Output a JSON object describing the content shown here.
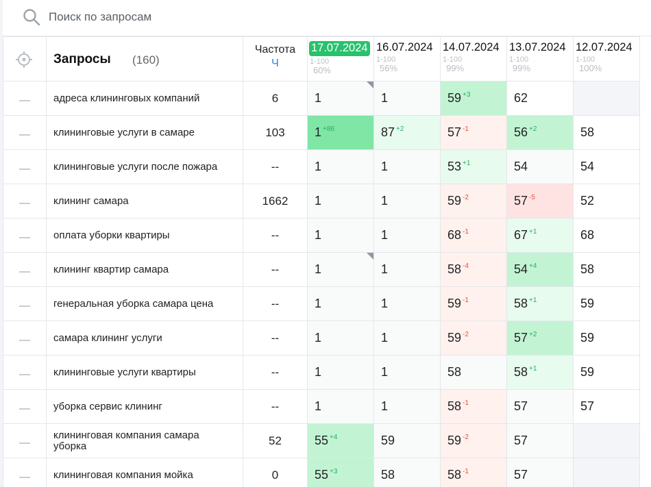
{
  "search": {
    "placeholder": "Поиск по запросам"
  },
  "header": {
    "queries_label": "Запросы",
    "queries_count": "(160)",
    "frequency_label": "Частота",
    "frequency_sub": "Ч"
  },
  "dates": [
    {
      "label": "17.07.2024",
      "range": "1-100",
      "pct": "60%",
      "active": true
    },
    {
      "label": "16.07.2024",
      "range": "1-100",
      "pct": "56%",
      "active": false
    },
    {
      "label": "14.07.2024",
      "range": "1-100",
      "pct": "99%",
      "active": false
    },
    {
      "label": "13.07.2024",
      "range": "1-100",
      "pct": "99%",
      "active": false
    },
    {
      "label": "12.07.2024",
      "range": "1-100",
      "pct": "100%",
      "active": false
    }
  ],
  "rows": [
    {
      "query": "адреса клининговых компаний",
      "freq": "6",
      "cells": [
        {
          "v": "1",
          "d": "",
          "bg": "neutral",
          "corner": true
        },
        {
          "v": "1",
          "d": "",
          "bg": "neutral"
        },
        {
          "v": "59",
          "d": "+3",
          "dir": "up",
          "bg": "green"
        },
        {
          "v": "62",
          "d": "",
          "bg": "none"
        },
        {
          "v": "",
          "d": "",
          "bg": "empty"
        }
      ]
    },
    {
      "query": "клининговые услуги в самаре",
      "freq": "103",
      "cells": [
        {
          "v": "1",
          "d": "+86",
          "dir": "up",
          "bg": "green-strong"
        },
        {
          "v": "87",
          "d": "+2",
          "dir": "up",
          "bg": "green-light"
        },
        {
          "v": "57",
          "d": "-1",
          "dir": "down",
          "bg": "red-light"
        },
        {
          "v": "56",
          "d": "+2",
          "dir": "up",
          "bg": "green"
        },
        {
          "v": "58",
          "d": "",
          "bg": "none"
        }
      ]
    },
    {
      "query": "клининговые услуги после пожара",
      "freq": "--",
      "cells": [
        {
          "v": "1",
          "d": "",
          "bg": "neutral"
        },
        {
          "v": "1",
          "d": "",
          "bg": "neutral"
        },
        {
          "v": "53",
          "d": "+1",
          "dir": "up",
          "bg": "green-light"
        },
        {
          "v": "54",
          "d": "",
          "bg": "neutral"
        },
        {
          "v": "54",
          "d": "",
          "bg": "none"
        }
      ]
    },
    {
      "query": "клининг самара",
      "freq": "1662",
      "cells": [
        {
          "v": "1",
          "d": "",
          "bg": "neutral"
        },
        {
          "v": "1",
          "d": "",
          "bg": "neutral"
        },
        {
          "v": "59",
          "d": "-2",
          "dir": "down",
          "bg": "red-light"
        },
        {
          "v": "57",
          "d": "-5",
          "dir": "down",
          "bg": "red"
        },
        {
          "v": "52",
          "d": "",
          "bg": "none"
        }
      ]
    },
    {
      "query": "оплата уборки квартиры",
      "freq": "--",
      "cells": [
        {
          "v": "1",
          "d": "",
          "bg": "neutral"
        },
        {
          "v": "1",
          "d": "",
          "bg": "neutral"
        },
        {
          "v": "68",
          "d": "-1",
          "dir": "down",
          "bg": "red-light"
        },
        {
          "v": "67",
          "d": "+1",
          "dir": "up",
          "bg": "green-light"
        },
        {
          "v": "68",
          "d": "",
          "bg": "none"
        }
      ]
    },
    {
      "query": "клининг квартир самара",
      "freq": "--",
      "cells": [
        {
          "v": "1",
          "d": "",
          "bg": "neutral",
          "corner": true
        },
        {
          "v": "1",
          "d": "",
          "bg": "neutral"
        },
        {
          "v": "58",
          "d": "-4",
          "dir": "down",
          "bg": "red-light"
        },
        {
          "v": "54",
          "d": "+4",
          "dir": "up",
          "bg": "green"
        },
        {
          "v": "58",
          "d": "",
          "bg": "none"
        }
      ]
    },
    {
      "query": "генеральная уборка самара цена",
      "freq": "--",
      "cells": [
        {
          "v": "1",
          "d": "",
          "bg": "neutral"
        },
        {
          "v": "1",
          "d": "",
          "bg": "neutral"
        },
        {
          "v": "59",
          "d": "-1",
          "dir": "down",
          "bg": "red-light"
        },
        {
          "v": "58",
          "d": "+1",
          "dir": "up",
          "bg": "green-light"
        },
        {
          "v": "59",
          "d": "",
          "bg": "none"
        }
      ]
    },
    {
      "query": "самара клининг услуги",
      "freq": "--",
      "cells": [
        {
          "v": "1",
          "d": "",
          "bg": "neutral"
        },
        {
          "v": "1",
          "d": "",
          "bg": "neutral"
        },
        {
          "v": "59",
          "d": "-2",
          "dir": "down",
          "bg": "red-light"
        },
        {
          "v": "57",
          "d": "+2",
          "dir": "up",
          "bg": "green"
        },
        {
          "v": "59",
          "d": "",
          "bg": "none"
        }
      ]
    },
    {
      "query": "клининговые услуги квартиры",
      "freq": "--",
      "cells": [
        {
          "v": "1",
          "d": "",
          "bg": "neutral"
        },
        {
          "v": "1",
          "d": "",
          "bg": "neutral"
        },
        {
          "v": "58",
          "d": "",
          "bg": "neutral"
        },
        {
          "v": "58",
          "d": "+1",
          "dir": "up",
          "bg": "green-light"
        },
        {
          "v": "59",
          "d": "",
          "bg": "none"
        }
      ]
    },
    {
      "query": "уборка сервис клининг",
      "freq": "--",
      "cells": [
        {
          "v": "1",
          "d": "",
          "bg": "neutral"
        },
        {
          "v": "1",
          "d": "",
          "bg": "neutral"
        },
        {
          "v": "58",
          "d": "-1",
          "dir": "down",
          "bg": "red-light"
        },
        {
          "v": "57",
          "d": "",
          "bg": "neutral"
        },
        {
          "v": "57",
          "d": "",
          "bg": "none"
        }
      ]
    },
    {
      "query": "клининговая компания самара уборка",
      "freq": "52",
      "cells": [
        {
          "v": "55",
          "d": "+4",
          "dir": "up",
          "bg": "green"
        },
        {
          "v": "59",
          "d": "",
          "bg": "neutral"
        },
        {
          "v": "59",
          "d": "-2",
          "dir": "down",
          "bg": "red-light"
        },
        {
          "v": "57",
          "d": "",
          "bg": "neutral"
        },
        {
          "v": "",
          "d": "",
          "bg": "empty"
        }
      ]
    },
    {
      "query": "клининговая компания мойка",
      "freq": "0",
      "cells": [
        {
          "v": "55",
          "d": "+3",
          "dir": "up",
          "bg": "green"
        },
        {
          "v": "58",
          "d": "",
          "bg": "neutral"
        },
        {
          "v": "58",
          "d": "-1",
          "dir": "down",
          "bg": "red-light"
        },
        {
          "v": "57",
          "d": "",
          "bg": "neutral"
        },
        {
          "v": "",
          "d": "",
          "bg": "empty"
        }
      ]
    }
  ]
}
